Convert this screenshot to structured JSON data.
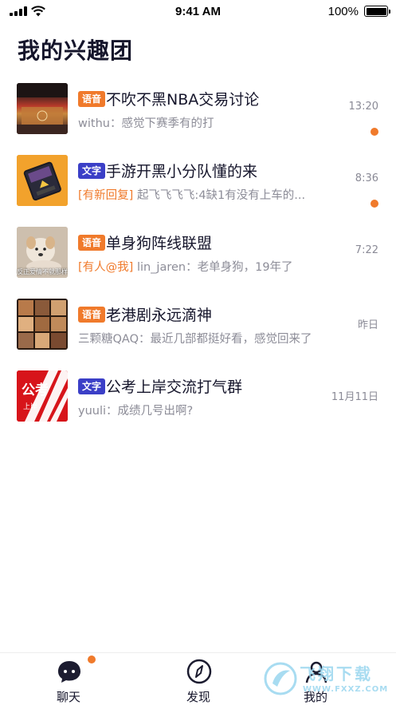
{
  "status_bar": {
    "time": "9:41 AM",
    "battery": "100%"
  },
  "page": {
    "title": "我的兴趣团"
  },
  "groups": [
    {
      "type_tag": "语音",
      "name": "不吹不黑NBA交易讨论",
      "time": "13:20",
      "prefix": "",
      "preview": "withu：感觉下赛季有的打",
      "unread": true,
      "avatar": "nba-arena-photo"
    },
    {
      "type_tag": "文字",
      "name": "手游开黑小分队懂的来",
      "time": "8:36",
      "prefix": "[有新回复]",
      "preview": "起飞飞飞飞:4缺1有没有上车的...",
      "unread": true,
      "avatar": "game-badge-icon"
    },
    {
      "type_tag": "语音",
      "name": "单身狗阵线联盟",
      "time": "7:22",
      "prefix": "[有人@我]",
      "preview": "lin_jaren：老单身狗，19年了",
      "unread": false,
      "avatar": "dog-photo",
      "avatar_caption": "反正爱情不就那样"
    },
    {
      "type_tag": "语音",
      "name": "老港剧永远滴神",
      "time": "昨日",
      "prefix": "",
      "preview": "三颗糖QAQ：最近几部都挺好看，感觉回来了",
      "unread": false,
      "avatar": "hk-drama-collage"
    },
    {
      "type_tag": "文字",
      "name": "公考上岸交流打气群",
      "time": "11月11日",
      "prefix": "",
      "preview": "yuuli：成绩几号出啊?",
      "unread": false,
      "avatar": "civil-exam-logo",
      "avatar_main": "公考",
      "avatar_sub": "上岸"
    }
  ],
  "tab_bar": {
    "tabs": [
      {
        "label": "聊天",
        "icon": "chat-bubble-icon",
        "badge": true
      },
      {
        "label": "发现",
        "icon": "compass-icon",
        "badge": false
      },
      {
        "label": "我的",
        "icon": "profile-icon",
        "badge": false
      }
    ]
  },
  "watermark": {
    "title": "飞翔下载",
    "url": "WWW.FXXZ.COM"
  },
  "colors": {
    "accent": "#f07a2b",
    "text_tag": "#3b3fc7",
    "title": "#15152b",
    "muted": "#8d8d98"
  }
}
